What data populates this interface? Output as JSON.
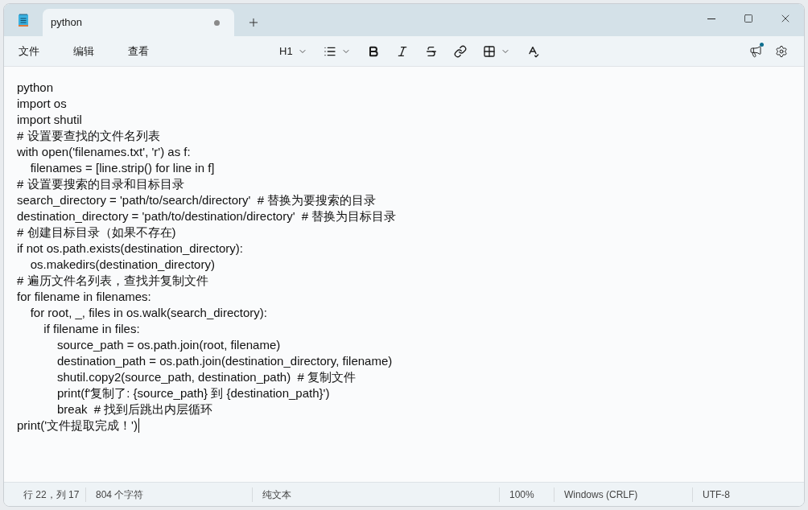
{
  "window": {
    "tab": {
      "title": "python",
      "unsaved": true,
      "selected": true
    }
  },
  "menu": [
    "文件",
    "编辑",
    "查看"
  ],
  "toolbar": [
    {
      "kind": "heading",
      "label": "H1"
    },
    {
      "kind": "list"
    },
    {
      "kind": "bold"
    },
    {
      "kind": "italic"
    },
    {
      "kind": "strikethrough"
    },
    {
      "kind": "link"
    },
    {
      "kind": "table"
    },
    {
      "kind": "clear-format"
    }
  ],
  "whats_new": {
    "has_news": true
  },
  "editor": {
    "cursor_at_end": true,
    "lines": [
      "python",
      "import os",
      "import shutil",
      "# 设置要查找的文件名列表",
      "with open('filenames.txt', 'r') as f:",
      "    filenames = [line.strip() for line in f]",
      "# 设置要搜索的目录和目标目录",
      "search_directory = 'path/to/search/directory'  # 替换为要搜索的目录",
      "destination_directory = 'path/to/destination/directory'  # 替换为目标目录",
      "# 创建目标目录（如果不存在)",
      "if not os.path.exists(destination_directory):",
      "    os.makedirs(destination_directory)",
      "# 遍历文件名列表，查找并复制文件",
      "for filename in filenames:",
      "    for root, _, files in os.walk(search_directory):",
      "        if filename in files:",
      "            source_path = os.path.join(root, filename)",
      "            destination_path = os.path.join(destination_directory, filename)",
      "            shutil.copy2(source_path, destination_path)  # 复制文件",
      "            print(f'复制了: {source_path} 到 {destination_path}')",
      "            break  # 找到后跳出内层循环",
      "print('文件提取完成！')"
    ]
  },
  "status_bar": {
    "position": "行 22，列 17",
    "characters": "804 个字符",
    "format": "纯文本",
    "zoom": "100%",
    "line_ending": "Windows (CRLF)",
    "encoding": "UTF-8"
  }
}
